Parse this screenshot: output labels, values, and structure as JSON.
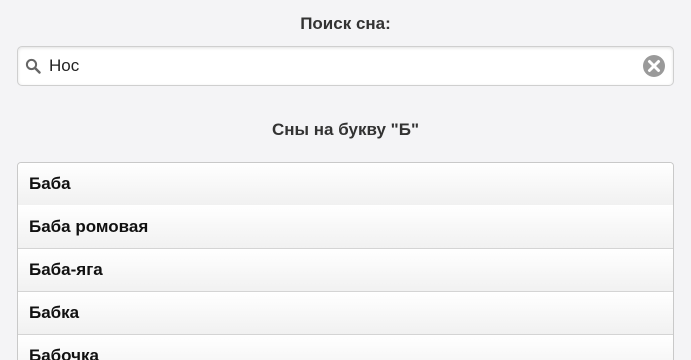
{
  "search": {
    "title": "Поиск сна:",
    "value": "Нос",
    "placeholder": ""
  },
  "section": {
    "title": "Сны на букву \"Б\""
  },
  "dreams": [
    {
      "label": "Баба"
    },
    {
      "label": "Баба ромовая"
    },
    {
      "label": "Баба-яга"
    },
    {
      "label": "Бабка"
    },
    {
      "label": "Бабочка"
    }
  ],
  "icons": {
    "search": "search-icon",
    "clear": "close-circle-icon"
  },
  "colors": {
    "background": "#f4f4f6",
    "text": "#333333",
    "border": "#c9c9c9",
    "clear_icon": "#9a9a9a"
  }
}
